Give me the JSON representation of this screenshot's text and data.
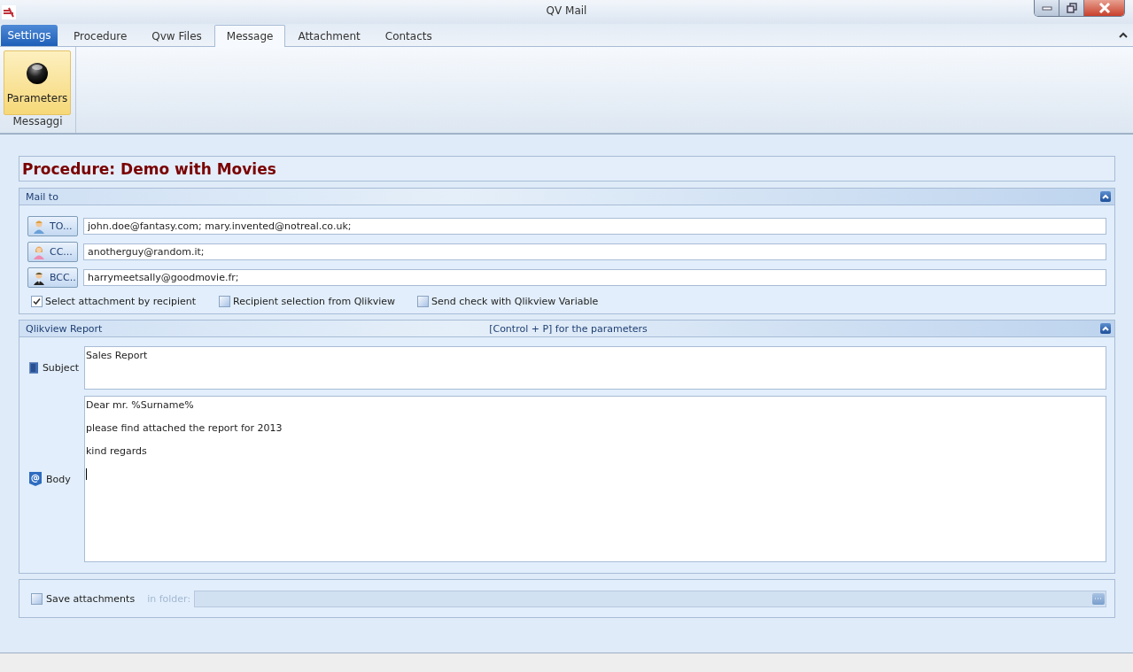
{
  "window": {
    "title": "QV Mail"
  },
  "app_menu": {
    "label": "Settings"
  },
  "tabs": [
    {
      "label": "Procedure",
      "selected": false
    },
    {
      "label": "Qvw Files",
      "selected": false
    },
    {
      "label": "Message",
      "selected": true
    },
    {
      "label": "Attachment",
      "selected": false
    },
    {
      "label": "Contacts",
      "selected": false
    }
  ],
  "ribbon": {
    "groups": [
      {
        "label": "Messaggi",
        "buttons": [
          {
            "label": "Parameters",
            "selected": true
          }
        ]
      }
    ]
  },
  "procedure_title": "Procedure: Demo with Movies",
  "mail_to": {
    "title": "Mail to",
    "recipients": [
      {
        "kind": "to",
        "button": "TO...",
        "value": "john.doe@fantasy.com; mary.invented@notreal.co.uk;"
      },
      {
        "kind": "cc",
        "button": "CC...",
        "value": "anotherguy@random.it;"
      },
      {
        "kind": "bcc",
        "button": "BCC..",
        "value": "harrymeetsally@goodmovie.fr;"
      }
    ],
    "options": [
      {
        "label": "Select attachment by recipient",
        "checked": true
      },
      {
        "label": "Recipient selection from Qlikview",
        "checked": false
      },
      {
        "label": "Send check with Qlikview Variable",
        "checked": false
      }
    ]
  },
  "report": {
    "title": "Qlikview Report",
    "hint": "[Control + P] for the parameters",
    "subject_label": "Subject",
    "subject": "Sales Report",
    "body_label": "Body",
    "body_lines": [
      "Dear mr. %Surname%",
      "please find attached the report for 2013",
      "kind regards"
    ]
  },
  "save": {
    "label": "Save attachments",
    "checked": false,
    "folder_label": "in folder:"
  }
}
